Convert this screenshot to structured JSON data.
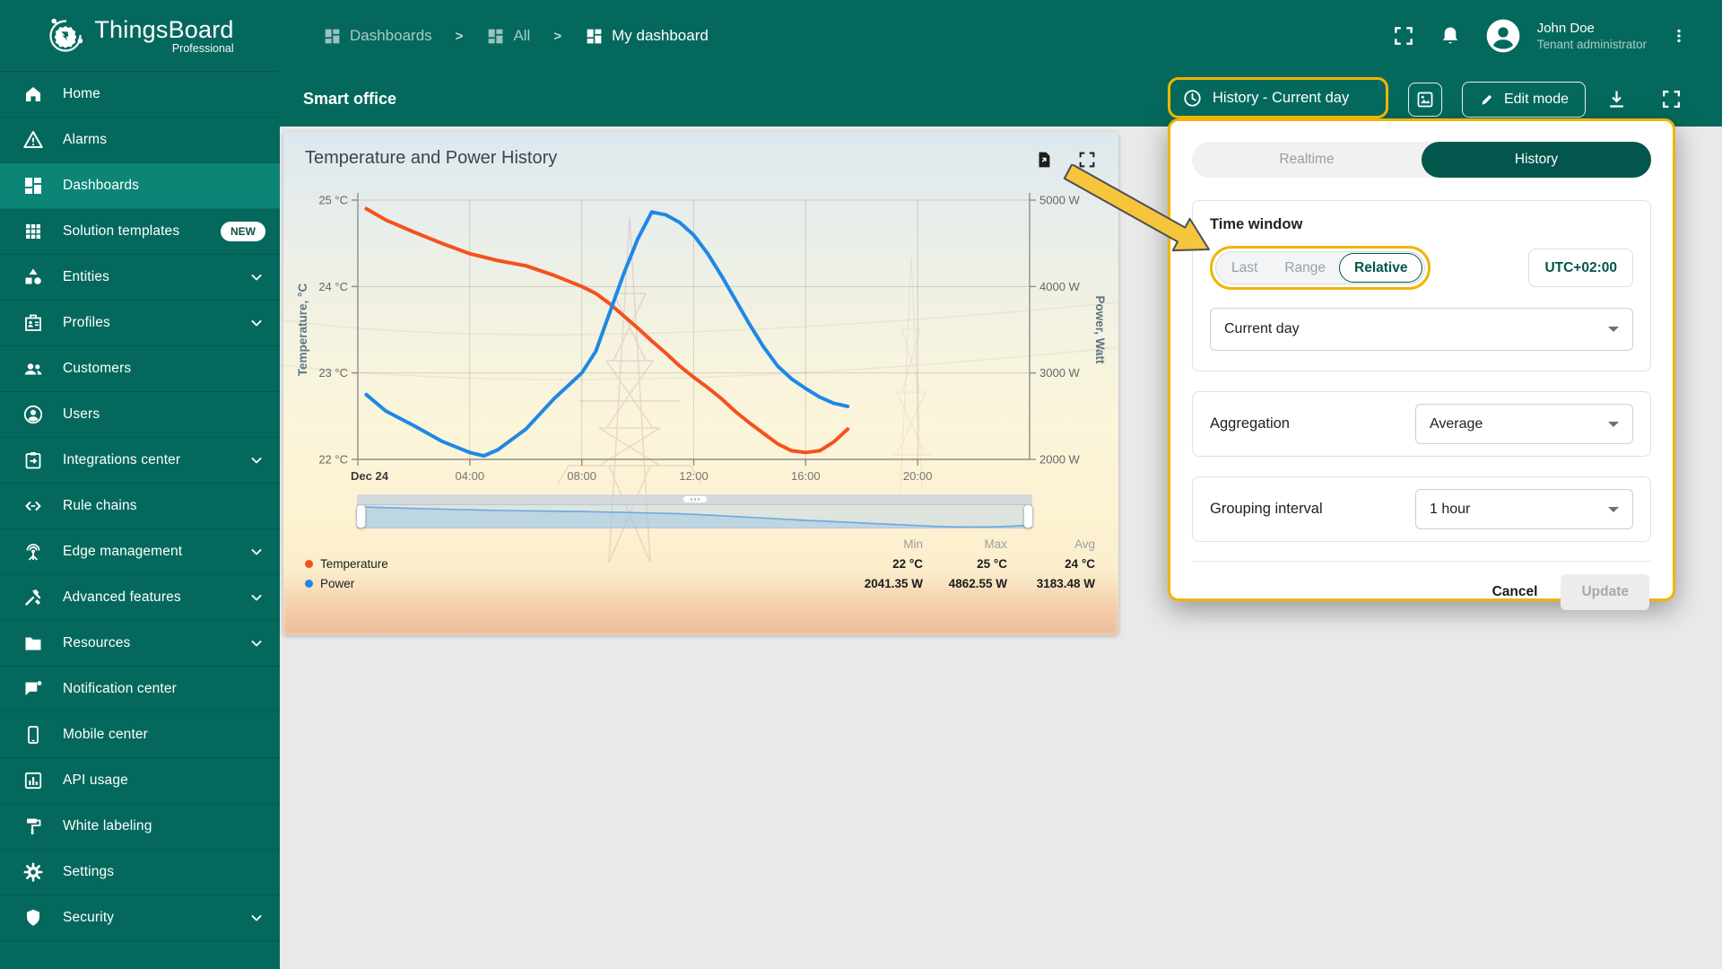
{
  "brand": {
    "name": "ThingsBoard",
    "subtitle": "Professional"
  },
  "sidebar": {
    "items": [
      {
        "id": "home",
        "label": "Home",
        "icon": "home"
      },
      {
        "id": "alarms",
        "label": "Alarms",
        "icon": "warning"
      },
      {
        "id": "dashboards",
        "label": "Dashboards",
        "icon": "dashboard",
        "selected": true
      },
      {
        "id": "solution-templates",
        "label": "Solution templates",
        "icon": "apps",
        "badge": "NEW"
      },
      {
        "id": "entities",
        "label": "Entities",
        "icon": "category",
        "expandable": true
      },
      {
        "id": "profiles",
        "label": "Profiles",
        "icon": "badge",
        "expandable": true
      },
      {
        "id": "customers",
        "label": "Customers",
        "icon": "people"
      },
      {
        "id": "users",
        "label": "Users",
        "icon": "person"
      },
      {
        "id": "integrations-center",
        "label": "Integrations center",
        "icon": "integration",
        "expandable": true
      },
      {
        "id": "rule-chains",
        "label": "Rule chains",
        "icon": "code"
      },
      {
        "id": "edge-management",
        "label": "Edge management",
        "icon": "antenna",
        "expandable": true
      },
      {
        "id": "advanced-features",
        "label": "Advanced features",
        "icon": "tools",
        "expandable": true
      },
      {
        "id": "resources",
        "label": "Resources",
        "icon": "folder",
        "expandable": true
      },
      {
        "id": "notification-center",
        "label": "Notification center",
        "icon": "message"
      },
      {
        "id": "mobile-center",
        "label": "Mobile center",
        "icon": "phone"
      },
      {
        "id": "api-usage",
        "label": "API usage",
        "icon": "chart"
      },
      {
        "id": "white-labeling",
        "label": "White labeling",
        "icon": "paint"
      },
      {
        "id": "settings",
        "label": "Settings",
        "icon": "gear"
      },
      {
        "id": "security",
        "label": "Security",
        "icon": "shield",
        "expandable": true
      }
    ]
  },
  "header": {
    "breadcrumbs": [
      {
        "label": "Dashboards",
        "icon": "dashboard"
      },
      {
        "label": "All",
        "icon": "dashboard"
      },
      {
        "label": "My dashboard",
        "icon": "dashboard",
        "current": true
      }
    ],
    "separator": ">",
    "user": {
      "name": "John Doe",
      "role": "Tenant administrator"
    }
  },
  "toolbar": {
    "dashboard_title": "Smart office",
    "timewindow_button": "History - Current day",
    "edit_mode_label": "Edit mode"
  },
  "chart_data": {
    "type": "line",
    "title": "Temperature and Power History",
    "x_axis": {
      "ticks": [
        "Dec 24",
        "04:00",
        "08:00",
        "12:00",
        "16:00",
        "20:00"
      ],
      "tick_hours": [
        0,
        4,
        8,
        12,
        16,
        20
      ],
      "range_hours": [
        0,
        24
      ],
      "grid": true
    },
    "y_left": {
      "label": "Temperature, °C",
      "ticks": [
        "25 °C",
        "24 °C",
        "23 °C",
        "22 °C"
      ],
      "range": [
        22,
        25
      ]
    },
    "y_right": {
      "label": "Power, Watt",
      "ticks": [
        "5000 W",
        "4000 W",
        "3000 W",
        "2000 W"
      ],
      "range": [
        2000,
        5000
      ]
    },
    "series": [
      {
        "name": "Temperature",
        "unit": "°C",
        "axis": "left",
        "color": "#f4511e",
        "points": [
          [
            0.3,
            24.9
          ],
          [
            1,
            24.77
          ],
          [
            2,
            24.63
          ],
          [
            3,
            24.5
          ],
          [
            4,
            24.38
          ],
          [
            5,
            24.3
          ],
          [
            6,
            24.24
          ],
          [
            7,
            24.13
          ],
          [
            8,
            24.0
          ],
          [
            8.5,
            23.92
          ],
          [
            9,
            23.8
          ],
          [
            9.5,
            23.66
          ],
          [
            10,
            23.52
          ],
          [
            10.5,
            23.37
          ],
          [
            11,
            23.23
          ],
          [
            11.5,
            23.08
          ],
          [
            12,
            22.95
          ],
          [
            12.5,
            22.83
          ],
          [
            13,
            22.7
          ],
          [
            13.5,
            22.55
          ],
          [
            14,
            22.42
          ],
          [
            14.5,
            22.3
          ],
          [
            15,
            22.18
          ],
          [
            15.5,
            22.1
          ],
          [
            16,
            22.08
          ],
          [
            16.5,
            22.1
          ],
          [
            17,
            22.2
          ],
          [
            17.5,
            22.35
          ]
        ]
      },
      {
        "name": "Power",
        "unit": "W",
        "axis": "right",
        "color": "#1e88e5",
        "points": [
          [
            0.3,
            2750
          ],
          [
            1,
            2560
          ],
          [
            2,
            2390
          ],
          [
            3,
            2210
          ],
          [
            4,
            2080
          ],
          [
            4.5,
            2041
          ],
          [
            5,
            2110
          ],
          [
            6,
            2350
          ],
          [
            7,
            2700
          ],
          [
            8,
            3000
          ],
          [
            8.5,
            3250
          ],
          [
            9,
            3700
          ],
          [
            9.5,
            4150
          ],
          [
            10,
            4550
          ],
          [
            10.5,
            4862
          ],
          [
            11,
            4830
          ],
          [
            11.5,
            4740
          ],
          [
            12,
            4595
          ],
          [
            12.5,
            4380
          ],
          [
            13,
            4120
          ],
          [
            13.5,
            3840
          ],
          [
            14,
            3560
          ],
          [
            14.5,
            3300
          ],
          [
            15,
            3080
          ],
          [
            15.5,
            2930
          ],
          [
            16,
            2820
          ],
          [
            16.5,
            2720
          ],
          [
            17,
            2650
          ],
          [
            17.5,
            2613
          ]
        ]
      }
    ],
    "legend": {
      "position": "bottom",
      "headers": [
        "Min",
        "Max",
        "Avg"
      ],
      "rows": [
        {
          "name": "Temperature",
          "color": "#f4511e",
          "min": "22 °C",
          "max": "25 °C",
          "avg": "24 °C"
        },
        {
          "name": "Power",
          "color": "#1e88e5",
          "min": "2041.35 W",
          "max": "4862.55 W",
          "avg": "3183.48 W"
        }
      ]
    }
  },
  "popup": {
    "tabs": [
      {
        "label": "Realtime"
      },
      {
        "label": "History",
        "selected": true
      }
    ],
    "time_window": {
      "heading": "Time window",
      "modes": [
        {
          "label": "Last"
        },
        {
          "label": "Range"
        },
        {
          "label": "Relative",
          "selected": true
        }
      ],
      "timezone": "UTC+02:00",
      "interval_value": "Current day"
    },
    "aggregation": {
      "label": "Aggregation",
      "value": "Average"
    },
    "grouping": {
      "label": "Grouping interval",
      "value": "1 hour"
    },
    "cancel_label": "Cancel",
    "update_label": "Update"
  },
  "colors": {
    "sidebar_teal": "#04695c",
    "selected_teal": "#0c8577",
    "deep_teal": "#02564c",
    "annotation_yellow": "#f2b400",
    "temperature_line": "#f4511e",
    "power_line": "#1e88e5"
  }
}
